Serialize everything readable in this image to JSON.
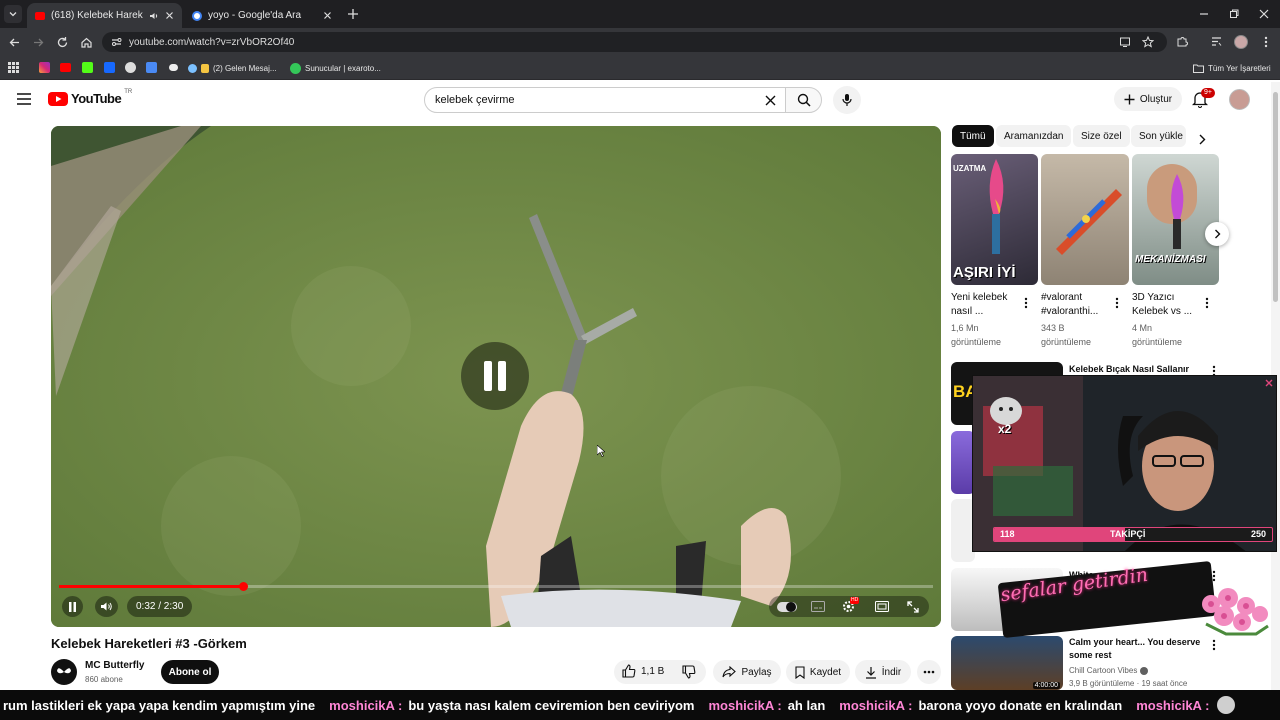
{
  "tabs": [
    {
      "title": "(618) Kelebek Hareketleri #",
      "active": true
    },
    {
      "title": "yoyo - Google'da Ara",
      "active": false
    }
  ],
  "address": {
    "url": "youtube.com/watch?v=zrVbOR2Of40"
  },
  "bookmarks": [
    {
      "label": "(2) Gelen Mesaj..."
    },
    {
      "label": "Sunucular | exaroto..."
    }
  ],
  "bookmarks_right": "Tüm Yer İşaretleri",
  "yt": {
    "logo_text": "YouTube",
    "region": "TR",
    "search_value": "kelebek çevirme",
    "create_label": "Oluştur",
    "notif_badge": "9+"
  },
  "player": {
    "time": "0:32 / 2:30",
    "progress_fraction": 0.21,
    "hd_badge": "HD"
  },
  "video": {
    "title": "Kelebek Hareketleri #3 -Görkem",
    "channel": "MC Butterfly",
    "subs": "860 abone",
    "subscribe_label": "Abone ol",
    "likes": "1,1 B",
    "share_label": "Paylaş",
    "save_label": "Kaydet",
    "download_label": "İndir"
  },
  "chips": [
    "Tümü",
    "Aramanızdan",
    "Size özel",
    "Son yükle"
  ],
  "shorts": [
    {
      "title1": "Yeni kelebek",
      "title2": "nasıl ...",
      "views1": "1,6 Mn",
      "views2": "görüntüleme",
      "overlay": "AŞIRI İYİ",
      "tag": "UZATMA"
    },
    {
      "title1": "#valorant",
      "title2": "#valoranthi...",
      "views1": "343 B",
      "views2": "görüntüleme"
    },
    {
      "title1": "3D Yazıcı",
      "title2": "Kelebek vs ...",
      "views1": "4 Mn",
      "views2": "görüntüleme",
      "overlay": "MEKANİZMASI"
    }
  ],
  "recs": [
    {
      "title": "Kelebek Bıçak Nasıl Sallanır",
      "thumb_text": "BA"
    },
    {
      "title": "White and Black Wallpaper"
    },
    {
      "title": "Calm your heart... You deserve some rest",
      "channel": "Chill Cartoon Vibes",
      "meta": "3,9 B görüntüleme · 19 saat önce",
      "duration": "4:00:00"
    }
  ],
  "overlay": {
    "stream_label": "TAKİPÇİ",
    "follow_current": "118",
    "follow_goal": "250",
    "cat_label": "x2",
    "sticker_text": "sefalar getirdin"
  },
  "ticker": [
    {
      "user": "",
      "msg": "rum lastikleri ek yapa yapa kendim yapmıştım yine"
    },
    {
      "user": "moshicikA :",
      "msg": "bu yaşta nası kalem ceviremion ben ceviriyom"
    },
    {
      "user": "moshicikA :",
      "msg": "ah lan"
    },
    {
      "user": "moshicikA :",
      "msg": "barona yoyo donate en kralından"
    },
    {
      "user": "moshicikA :",
      "msg": ""
    }
  ],
  "colors": {
    "yt_red": "#ff0000",
    "progress": "#f00",
    "chrome_dark": "#35363a",
    "overlay_pink": "#e0457b"
  }
}
